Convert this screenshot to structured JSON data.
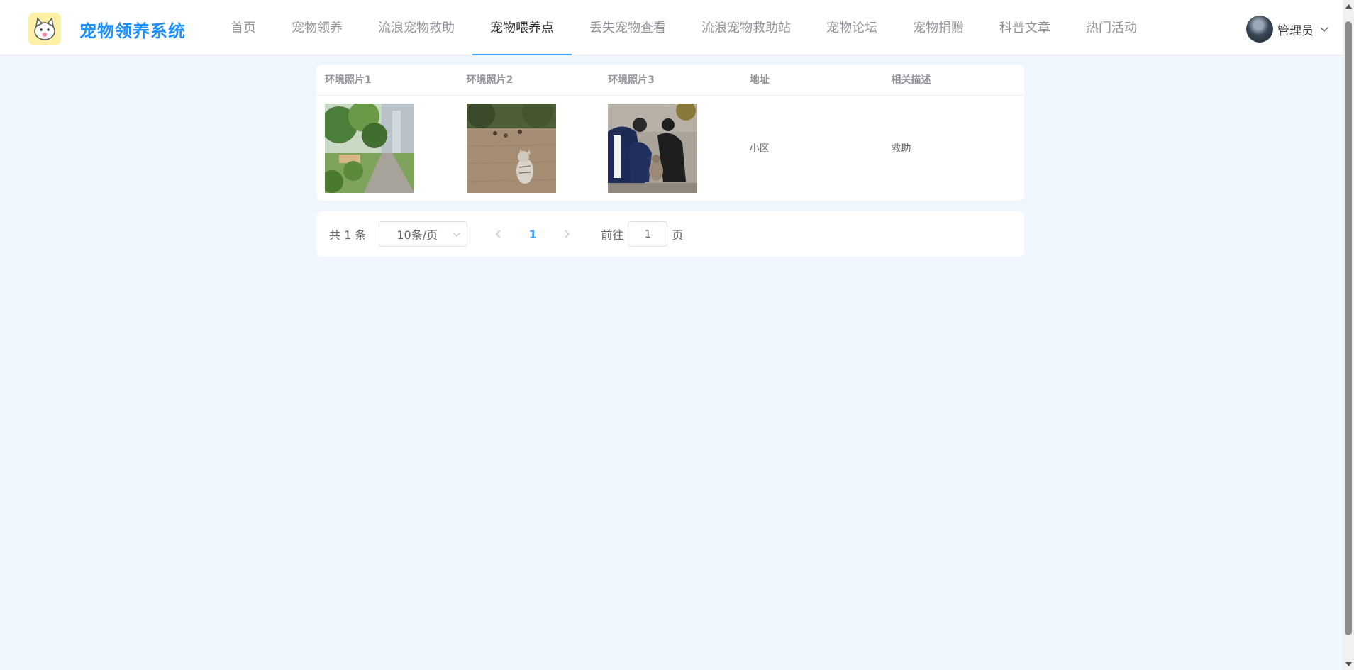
{
  "header": {
    "brand": "宠物领养系统",
    "logo_icon": "cat-icon",
    "nav": [
      {
        "label": "首页",
        "active": false
      },
      {
        "label": "宠物领养",
        "active": false
      },
      {
        "label": "流浪宠物救助",
        "active": false
      },
      {
        "label": "宠物喂养点",
        "active": true
      },
      {
        "label": "丢失宠物查看",
        "active": false
      },
      {
        "label": "流浪宠物救助站",
        "active": false
      },
      {
        "label": "宠物论坛",
        "active": false
      },
      {
        "label": "宠物捐赠",
        "active": false
      },
      {
        "label": "科普文章",
        "active": false
      },
      {
        "label": "热门活动",
        "active": false
      }
    ],
    "user": {
      "name": "管理员",
      "avatar_icon": "user-avatar-icon"
    }
  },
  "table": {
    "columns": [
      "环境照片1",
      "环境照片2",
      "环境照片3",
      "地址",
      "相关描述"
    ],
    "rows": [
      {
        "photo1": "garden-path-photo",
        "photo2": "cat-on-pavement-photo",
        "photo3": "people-with-dog-photo",
        "address": "小区",
        "description": "救助"
      }
    ]
  },
  "pagination": {
    "total": "共 1 条",
    "page_size": "10条/页",
    "current_page": "1",
    "goto_label": "前往",
    "goto_value": "1",
    "goto_suffix": "页"
  },
  "colors": {
    "accent": "#409eff",
    "brand": "#1e90ff",
    "background": "#eff6fe"
  }
}
